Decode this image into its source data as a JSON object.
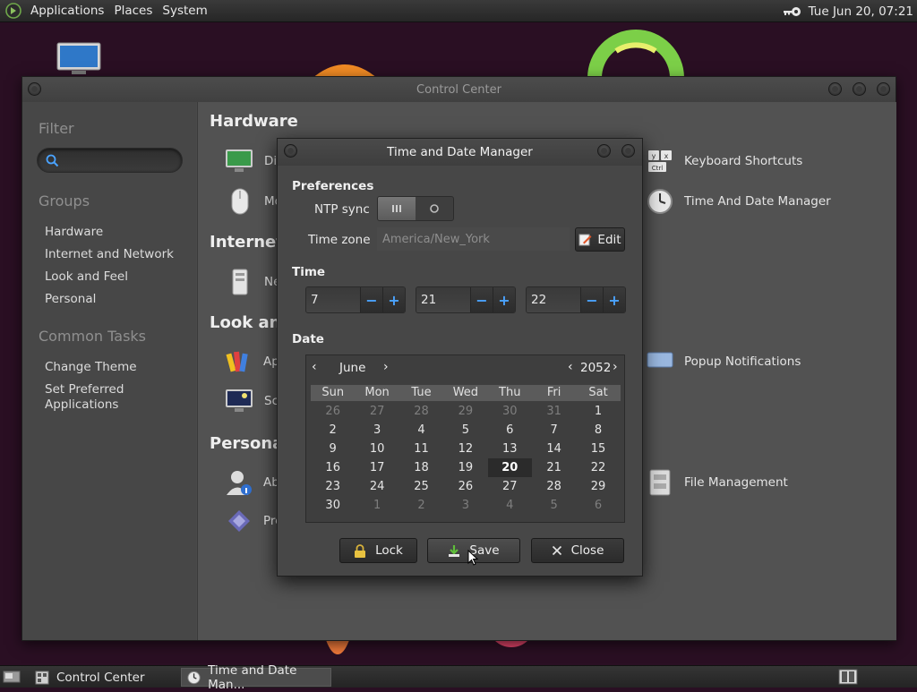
{
  "top_panel": {
    "menus": [
      "Applications",
      "Places",
      "System"
    ],
    "clock": "Tue Jun 20, 07:21"
  },
  "control_center": {
    "title": "Control Center",
    "sidebar": {
      "filter_heading": "Filter",
      "search_placeholder": "",
      "groups_heading": "Groups",
      "groups": [
        "Hardware",
        "Internet and Network",
        "Look and Feel",
        "Personal"
      ],
      "tasks_heading": "Common Tasks",
      "tasks": [
        "Change Theme",
        "Set Preferred Applications"
      ]
    },
    "categories": {
      "hardware": "Hardware",
      "internet": "Internet a",
      "look": "Look and",
      "personal": "Personal"
    },
    "items": {
      "display": "Dis",
      "mouse": "Mo",
      "network": "Ne",
      "appearance": "Ap",
      "screensaver": "Scr",
      "about_me": "Abo",
      "preferred": "Pre",
      "keyboard_shortcuts": "Keyboard Shortcuts",
      "time_date": "Time And Date Manager",
      "popup_notifications": "Popup Notifications",
      "file_management": "File Management"
    }
  },
  "dialog": {
    "title": "Time and Date Manager",
    "preferences_label": "Preferences",
    "ntp_label": "NTP sync",
    "timezone_label": "Time zone",
    "timezone_value": "America/New_York",
    "edit_label": "Edit",
    "time_label": "Time",
    "hour": "7",
    "minute": "21",
    "second": "22",
    "date_label": "Date",
    "calendar": {
      "month": "June",
      "year": "2052",
      "day_names": [
        "Sun",
        "Mon",
        "Tue",
        "Wed",
        "Thu",
        "Fri",
        "Sat"
      ],
      "weeks": [
        [
          "26",
          "27",
          "28",
          "29",
          "30",
          "31",
          "1"
        ],
        [
          "2",
          "3",
          "4",
          "5",
          "6",
          "7",
          "8"
        ],
        [
          "9",
          "10",
          "11",
          "12",
          "13",
          "14",
          "15"
        ],
        [
          "16",
          "17",
          "18",
          "19",
          "20",
          "21",
          "22"
        ],
        [
          "23",
          "24",
          "25",
          "26",
          "27",
          "28",
          "29"
        ],
        [
          "30",
          "1",
          "2",
          "3",
          "4",
          "5",
          "6"
        ]
      ],
      "selected_day": "20"
    },
    "lock_label": "Lock",
    "save_label": "Save",
    "close_label": "Close"
  },
  "taskbar": {
    "tasks": [
      "Control Center",
      "Time and Date Man..."
    ]
  },
  "colors": {
    "accent_blue": "#4aa3ff",
    "desktop_bg": "#2a0f23"
  }
}
